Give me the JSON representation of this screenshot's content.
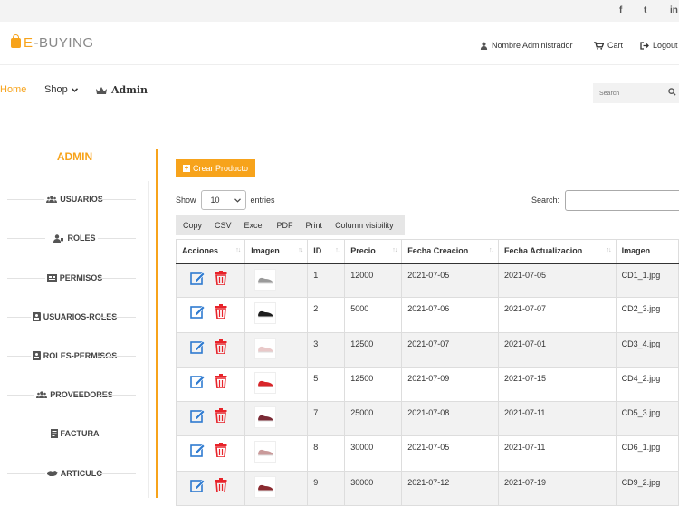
{
  "brand": {
    "prefix": "E",
    "name": "-BUYING"
  },
  "header": {
    "admin_name": "Nombre Administrador",
    "cart": "Cart",
    "logout": "Logout"
  },
  "social": [
    "f",
    "t",
    "in"
  ],
  "nav": {
    "home": "Home",
    "shop": "Shop",
    "admin": "Admin"
  },
  "search": {
    "placeholder": "Search"
  },
  "sidebar": {
    "title": "ADMIN",
    "items": [
      {
        "label": "USUARIOS",
        "icon": "users-icon"
      },
      {
        "label": "ROLES",
        "icon": "user-tag-icon"
      },
      {
        "label": "PERMISOS",
        "icon": "permissions-icon"
      },
      {
        "label": "USUARIOS-ROLES",
        "icon": "id-card-icon"
      },
      {
        "label": "ROLES-PERMISOS",
        "icon": "id-card-icon"
      },
      {
        "label": "PROVEEDORES",
        "icon": "users-icon"
      },
      {
        "label": "FACTURA",
        "icon": "invoice-icon"
      },
      {
        "label": "ARTICULO",
        "icon": "article-icon"
      }
    ]
  },
  "toolbar": {
    "create_label": "Crear Producto",
    "show_label": "Show",
    "entries_value": "10",
    "entries_label": "entries",
    "search_label": "Search:",
    "buttons": [
      "Copy",
      "CSV",
      "Excel",
      "PDF",
      "Print",
      "Column visibility"
    ]
  },
  "table": {
    "columns": [
      "Acciones",
      "Imagen",
      "ID",
      "Precio",
      "Fecha Creacion",
      "Fecha Actualizacion",
      "Imagen"
    ],
    "rows": [
      {
        "id": "1",
        "precio": "12000",
        "creacion": "2021-07-05",
        "actualizacion": "2021-07-05",
        "imagen": "CD1_1.jpg",
        "shoe_color": "#9a9a9a"
      },
      {
        "id": "2",
        "precio": "5000",
        "creacion": "2021-07-06",
        "actualizacion": "2021-07-07",
        "imagen": "CD2_3.jpg",
        "shoe_color": "#1e1e1e"
      },
      {
        "id": "3",
        "precio": "12500",
        "creacion": "2021-07-07",
        "actualizacion": "2021-07-01",
        "imagen": "CD3_4.jpg",
        "shoe_color": "#e9c9c9"
      },
      {
        "id": "5",
        "precio": "12500",
        "creacion": "2021-07-09",
        "actualizacion": "2021-07-15",
        "imagen": "CD4_2.jpg",
        "shoe_color": "#d9262a"
      },
      {
        "id": "7",
        "precio": "25000",
        "creacion": "2021-07-08",
        "actualizacion": "2021-07-11",
        "imagen": "CD5_3.jpg",
        "shoe_color": "#7a2a35"
      },
      {
        "id": "8",
        "precio": "30000",
        "creacion": "2021-07-05",
        "actualizacion": "2021-07-11",
        "imagen": "CD6_1.jpg",
        "shoe_color": "#c99a9a"
      },
      {
        "id": "9",
        "precio": "30000",
        "creacion": "2021-07-12",
        "actualizacion": "2021-07-19",
        "imagen": "CD9_2.jpg",
        "shoe_color": "#8a2a30"
      }
    ]
  },
  "colors": {
    "accent": "#f7a31b",
    "edit": "#2f7bd0",
    "delete": "#e8232a"
  }
}
